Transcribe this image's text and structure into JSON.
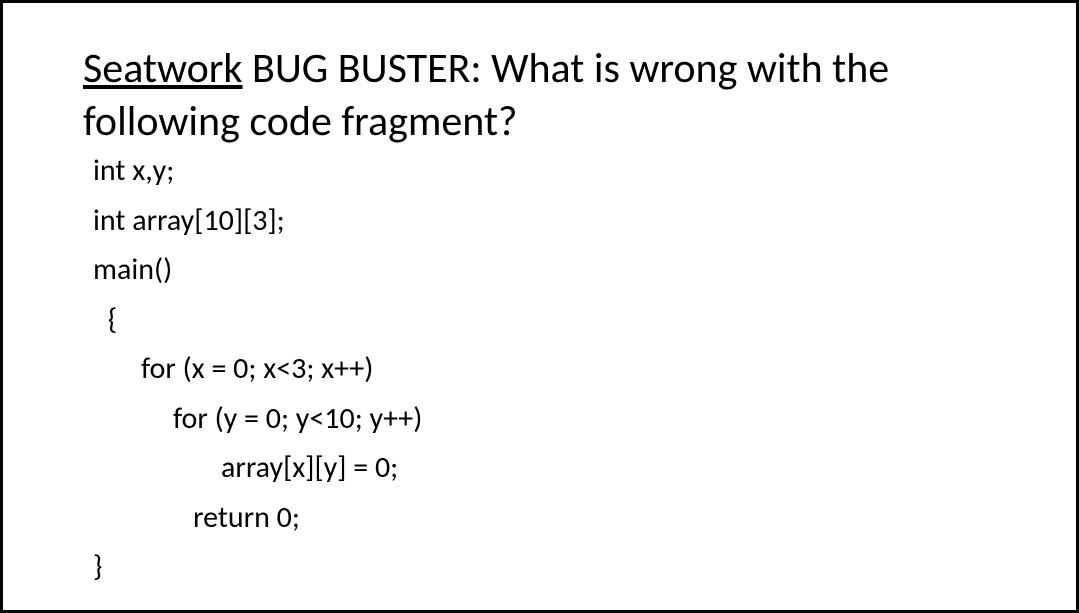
{
  "title": {
    "underlined": "Seatwork",
    "rest": " BUG BUSTER: What is wrong with the following code fragment?"
  },
  "code": {
    "line1": "int x,y;",
    "line2": "int array[10][3];",
    "line3": "main()",
    "line4": " {",
    "line5": "for (x = 0; x<3; x++)",
    "line6": "for (y = 0; y<10; y++)",
    "line7": "array[x][y] = 0;",
    "line8": "return 0;",
    "line9": "}"
  }
}
